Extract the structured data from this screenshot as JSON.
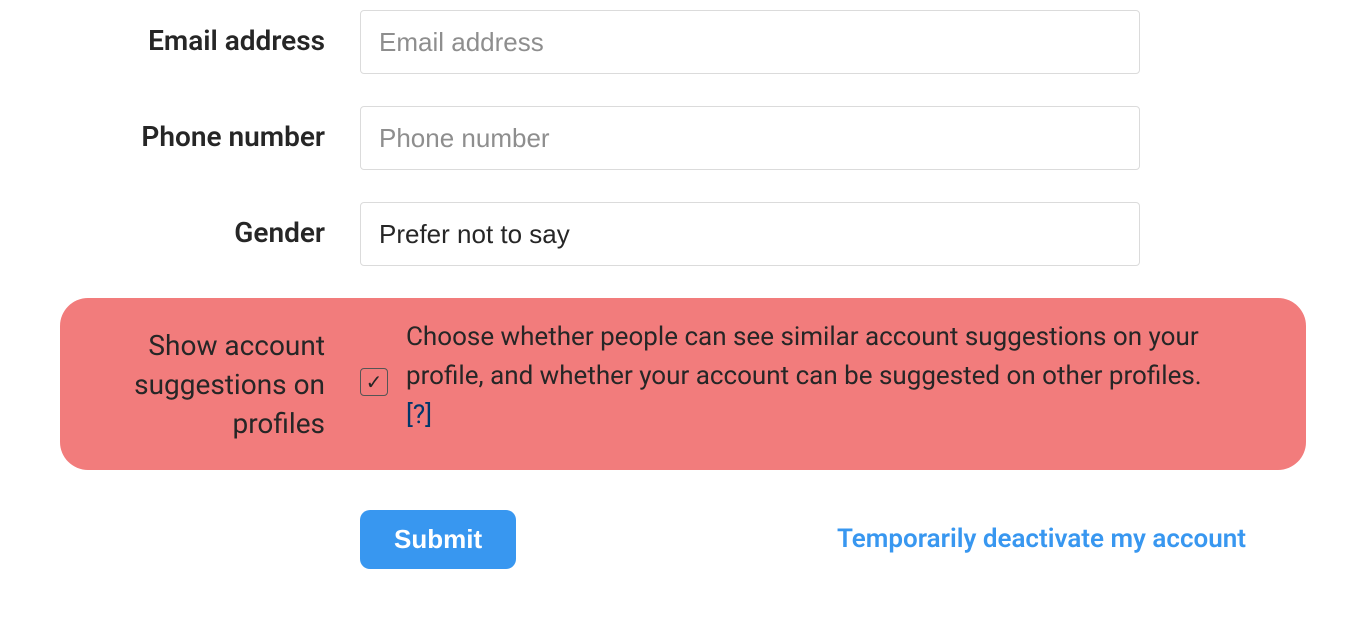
{
  "form": {
    "email": {
      "label": "Email address",
      "placeholder": "Email address",
      "value": ""
    },
    "phone": {
      "label": "Phone number",
      "placeholder": "Phone number",
      "value": ""
    },
    "gender": {
      "label": "Gender",
      "value": "Prefer not to say"
    },
    "suggestions": {
      "label": "Show account suggestions on profiles",
      "checked": true,
      "description": "Choose whether people can see similar account suggestions on your profile, and whether your account can be suggested on other profiles.",
      "help_text": "[?]"
    },
    "submit_label": "Submit",
    "deactivate_label": "Temporarily deactivate my account"
  }
}
